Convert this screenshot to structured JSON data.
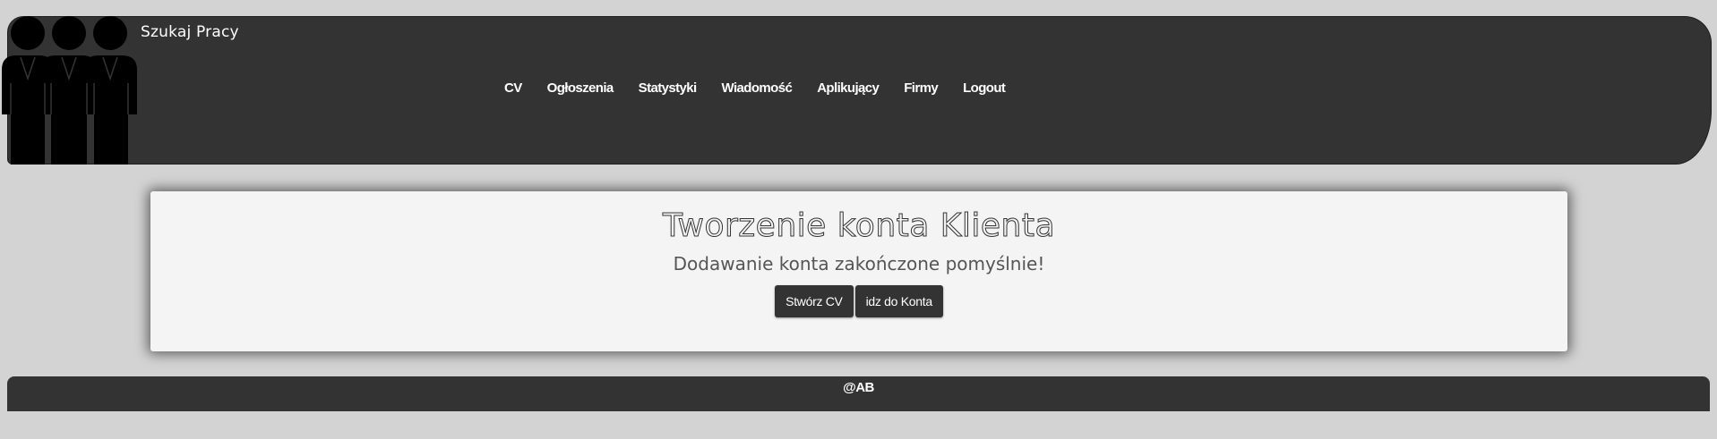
{
  "header": {
    "brand": "Szukaj Pracy",
    "logo_icon": "people-group-icon",
    "nav": [
      {
        "label": "CV"
      },
      {
        "label": "Ogłoszenia"
      },
      {
        "label": "Statystyki"
      },
      {
        "label": "Wiadomość"
      },
      {
        "label": "Aplikujący"
      },
      {
        "label": "Firmy"
      },
      {
        "label": "Logout"
      }
    ]
  },
  "main": {
    "title": "Tworzenie konta Klienta",
    "message": "Dodawanie konta zakończone pomyślnie!",
    "buttons": {
      "create_cv": "Stwórz CV",
      "go_to_account": "idz do Konta"
    }
  },
  "footer": {
    "text": "@AB"
  },
  "colors": {
    "background": "#d3d3d3",
    "header": "#333333",
    "card": "#f4f4f4",
    "button": "#333333"
  }
}
